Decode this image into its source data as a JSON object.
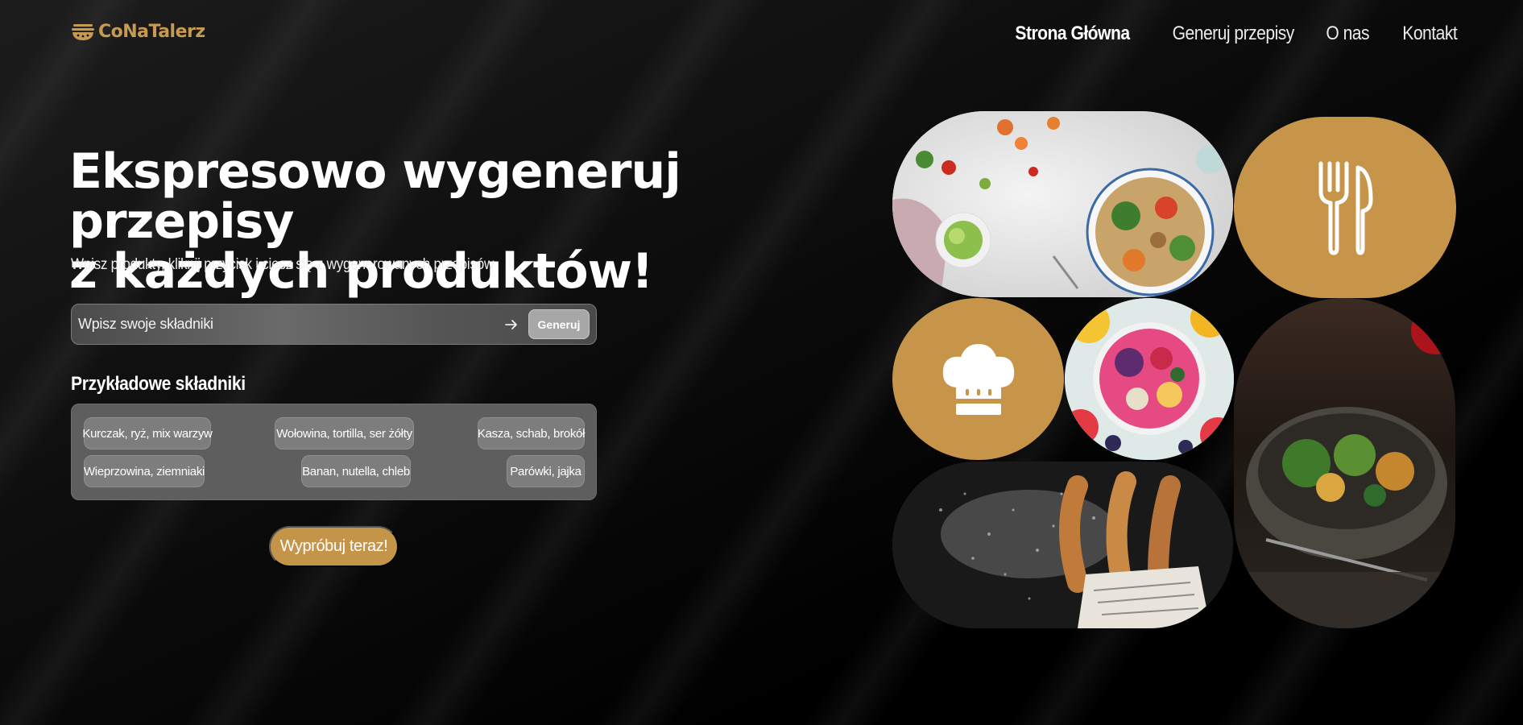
{
  "brand": {
    "name": "CoNaTalerz",
    "color": "#c79a52"
  },
  "nav": {
    "items": [
      {
        "label": "Strona Główna",
        "active": true
      },
      {
        "label": "Generuj przepisy",
        "active": false
      },
      {
        "label": "O nas",
        "active": false
      },
      {
        "label": "Kontakt",
        "active": false
      }
    ]
  },
  "hero": {
    "title_line1": "Ekspresowo wygeneruj przepisy",
    "title_line2": "z każdych produktów!",
    "subtitle": "Wpisz produkty, kliknij przycisk i ciesz się z wygenerowanych przepisów"
  },
  "search": {
    "placeholder": "Wpisz swoje składniki",
    "value": "",
    "button_label": "Generuj",
    "icon": "arrow-right-icon"
  },
  "examples": {
    "title": "Przykładowe składniki",
    "chips": [
      "Kurczak, ryż, mix warzyw",
      "Wołowina, tortilla, ser żółty",
      "Kasza, schab, brokół",
      "Wieprzowina, ziemniaki",
      "Banan, nutella, chleb",
      "Parówki, jajka"
    ]
  },
  "cta": {
    "label": "Wypróbuj teraz!"
  },
  "collage": {
    "accent": "#c79549",
    "tiles": [
      {
        "kind": "photo",
        "subject": "salad-bowl-photo"
      },
      {
        "kind": "icon",
        "icon": "fork-knife-icon"
      },
      {
        "kind": "icon",
        "icon": "chef-hat-icon"
      },
      {
        "kind": "photo",
        "subject": "smoothie-bowl-photo"
      },
      {
        "kind": "photo",
        "subject": "salad-dark-photo"
      },
      {
        "kind": "photo",
        "subject": "churros-photo"
      }
    ]
  }
}
